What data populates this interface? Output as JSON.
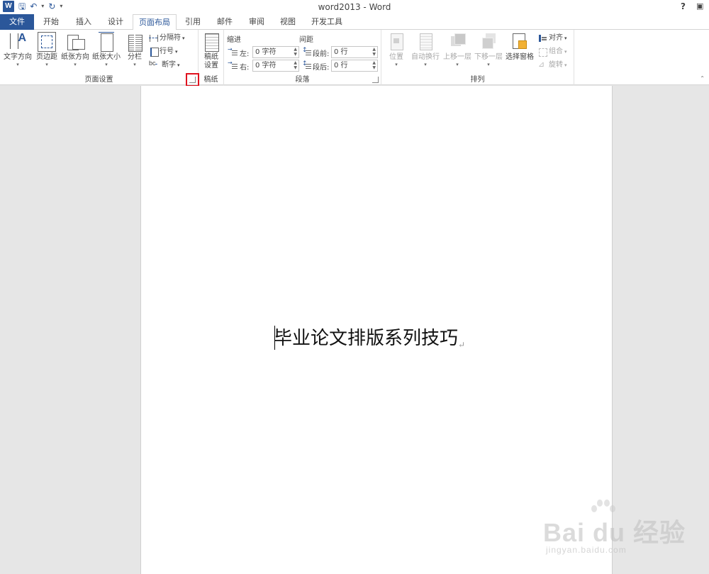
{
  "titlebar": {
    "app_icon": "W",
    "title": "word2013 - Word",
    "help": "?",
    "qat_icons": [
      "save-icon",
      "undo-icon",
      "redo-icon",
      "customize-qat-icon"
    ]
  },
  "tabs": [
    "文件",
    "开始",
    "插入",
    "设计",
    "页面布局",
    "引用",
    "邮件",
    "审阅",
    "视图",
    "开发工具"
  ],
  "active_tab": "页面布局",
  "ribbon": {
    "page_setup": {
      "label": "页面设置",
      "text_direction": "文字方向",
      "margins": "页边距",
      "orientation": "纸张方向",
      "size": "纸张大小",
      "columns": "分栏",
      "breaks": "分隔符",
      "line_numbers": "行号",
      "hyphenation": "断字"
    },
    "manuscript": {
      "label": "稿纸",
      "settings_line1": "稿纸",
      "settings_line2": "设置"
    },
    "paragraph": {
      "label": "段落",
      "indent_title": "缩进",
      "spacing_title": "间距",
      "left_label": "左:",
      "left_value": "0 字符",
      "right_label": "右:",
      "right_value": "0 字符",
      "before_label": "段前:",
      "before_value": "0 行",
      "after_label": "段后:",
      "after_value": "0 行"
    },
    "arrange": {
      "label": "排列",
      "position": "位置",
      "wrap_text": "自动换行",
      "bring_forward": "上移一层",
      "send_backward": "下移一层",
      "selection_pane": "选择窗格",
      "align": "对齐",
      "group": "组合",
      "rotate": "旋转"
    }
  },
  "document": {
    "text": "毕业论文排版系列技巧",
    "paragraph_mark": "↵"
  },
  "watermark": {
    "brand": "Bai du 经验",
    "sub": "jingyan.baidu.com"
  },
  "colors": {
    "accent": "#2b579a",
    "highlight_box": "#e0121f"
  }
}
